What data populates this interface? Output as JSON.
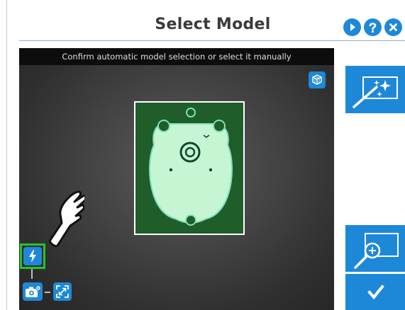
{
  "header": {
    "title": "Select Model",
    "buttons": [
      {
        "name": "play-icon"
      },
      {
        "name": "help-icon"
      },
      {
        "name": "close-icon"
      }
    ]
  },
  "camera": {
    "banner": "Confirm automatic model selection or select it manually",
    "icons": [
      "cube-icon",
      "lightning-icon",
      "camera-settings-icon",
      "expand-icon",
      "hand-pointer-icon"
    ]
  },
  "side": {
    "icons": [
      "magic-wand-icon",
      "zoom-in-icon",
      "checkmark-icon"
    ]
  },
  "colors": {
    "accent": "#1e88d8",
    "highlight": "#27c427",
    "model_fill": "#c6f5d4",
    "roi_bg": "#1f5d2a"
  }
}
